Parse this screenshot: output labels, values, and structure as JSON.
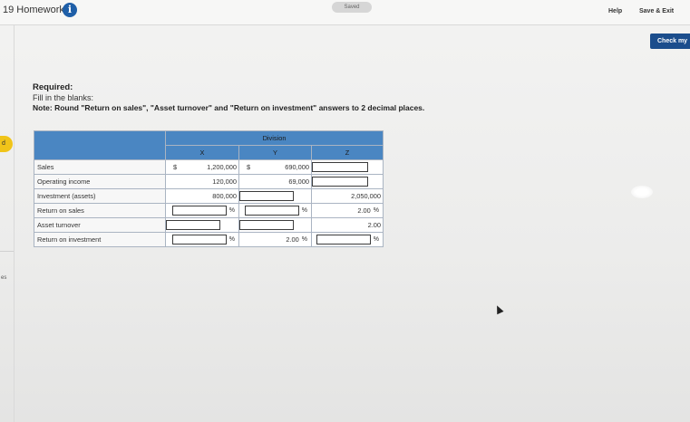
{
  "header": {
    "title": "19 Homework",
    "saved_label": "Saved",
    "help_label": "Help",
    "save_exit_label": "Save & Exit",
    "check_label": "Check my"
  },
  "rail": {
    "badge": "d",
    "side_text": "es"
  },
  "instructions": {
    "required": "Required:",
    "fill": "Fill in the blanks:",
    "note": "Note: Round \"Return on sales\", \"Asset turnover\" and \"Return on investment\" answers to 2 decimal places."
  },
  "table": {
    "group_header": "Division",
    "columns": [
      "X",
      "Y",
      "Z"
    ],
    "rows": [
      {
        "label": "Sales",
        "x": "1,200,000",
        "x_prefix": "$",
        "y": "690,000",
        "y_prefix": "$",
        "z": ""
      },
      {
        "label": "Operating income",
        "x": "120,000",
        "y": "69,000",
        "z": ""
      },
      {
        "label": "Investment (assets)",
        "x": "800,000",
        "y": "",
        "z": "2,050,000"
      },
      {
        "label": "Return on sales",
        "x": "",
        "y": "",
        "z": "2.00"
      },
      {
        "label": "Asset turnover",
        "x": "",
        "y": "",
        "z": "2.00"
      },
      {
        "label": "Return on investment",
        "x": "",
        "y": "2.00",
        "z": ""
      }
    ],
    "pct_symbol": "%"
  },
  "colors": {
    "header_blue": "#4a86c2",
    "button_blue": "#1b4d8c",
    "badge_yellow": "#f0c419"
  }
}
